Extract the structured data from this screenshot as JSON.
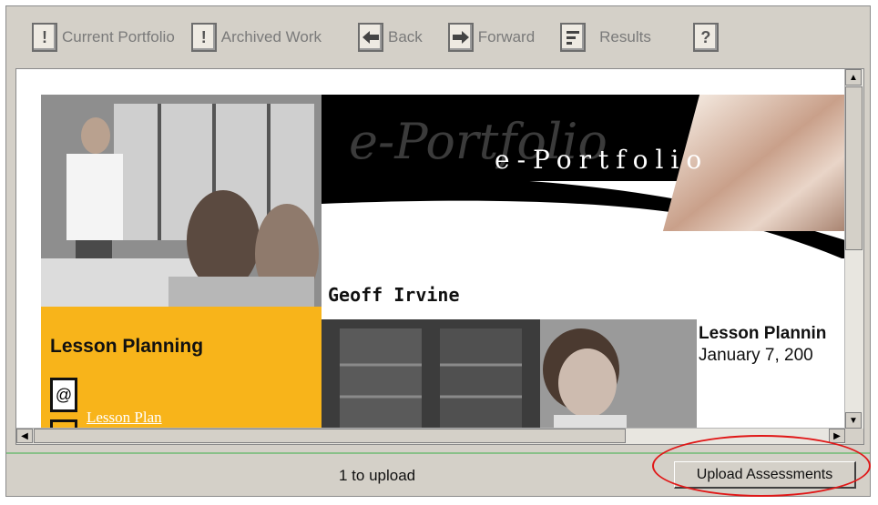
{
  "toolbar": {
    "current_portfolio": "Current Portfolio",
    "archived_work": "Archived Work",
    "back": "Back",
    "forward": "Forward",
    "results": "Results"
  },
  "content": {
    "banner_title": "e-Portfolio",
    "banner_ghost": "e-Portfolio",
    "name": "Geoff Irvine",
    "lesson_heading": "Lesson Planning",
    "lesson_link": "Lesson Plan",
    "right_title": "Lesson Plannin",
    "right_date": "January 7, 200"
  },
  "status": {
    "upload_count": "1 to upload",
    "upload_button": "Upload Assessments"
  },
  "colors": {
    "accent_yellow": "#f8b41a",
    "highlight_red": "#e01818",
    "window_gray": "#d4d0c8"
  },
  "icons": [
    "current-portfolio-icon",
    "archived-work-icon",
    "back-arrow-icon",
    "forward-arrow-icon",
    "results-icon",
    "help-icon"
  ]
}
